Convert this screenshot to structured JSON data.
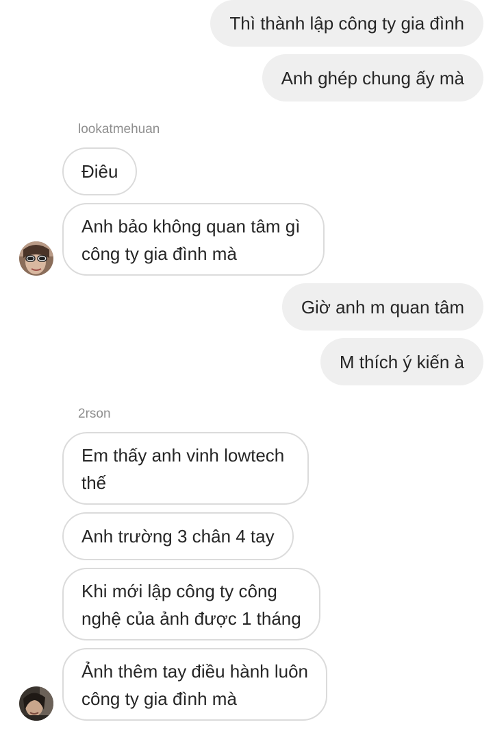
{
  "messages": [
    {
      "id": "m1",
      "direction": "outgoing",
      "lines": [
        "Thì thành lập công ty gia đình"
      ]
    },
    {
      "id": "m2",
      "direction": "outgoing",
      "lines": [
        "Anh ghép chung ấy mà"
      ]
    },
    {
      "id": "m3",
      "direction": "incoming",
      "sender": "lookatmehuan",
      "lines": [
        "Điêu"
      ]
    },
    {
      "id": "m4",
      "direction": "incoming",
      "lines": [
        "Anh bảo không quan tâm gì",
        "công ty gia đình mà"
      ]
    },
    {
      "id": "m5",
      "direction": "outgoing",
      "lines": [
        "Giờ anh m quan tâm"
      ]
    },
    {
      "id": "m6",
      "direction": "outgoing",
      "lines": [
        "M thích ý kiến à"
      ]
    },
    {
      "id": "m7",
      "direction": "incoming",
      "sender": "2rson",
      "lines": [
        "Em thấy anh vinh lowtech",
        "thế"
      ]
    },
    {
      "id": "m8",
      "direction": "incoming",
      "lines": [
        "Anh trường 3 chân 4 tay"
      ]
    },
    {
      "id": "m9",
      "direction": "incoming",
      "lines": [
        "Khi mới lập công ty công",
        "nghệ của ảnh được 1 tháng"
      ]
    },
    {
      "id": "m10",
      "direction": "incoming",
      "lines": [
        "Ảnh thêm tay điều hành luôn",
        "công ty gia đình mà"
      ]
    }
  ],
  "senders": {
    "first": "lookatmehuan",
    "second": "2rson"
  },
  "colors": {
    "outgoing_bubble": "#efefef",
    "incoming_border": "#dbdbdb",
    "text": "#262626",
    "sender_label": "#8e8e8e"
  }
}
